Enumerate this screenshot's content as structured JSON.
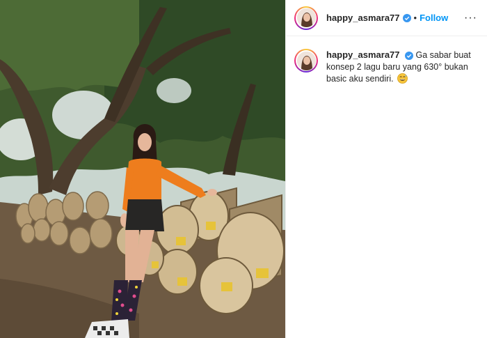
{
  "post": {
    "image_alt": "Woman in orange top sitting on stacked logs under trees"
  },
  "header": {
    "username": "happy_asmara77",
    "separator": "•",
    "follow_label": "Follow",
    "more_label": "···"
  },
  "caption": {
    "username": "happy_asmara77",
    "text": "Ga sabar buat konsep 2 lagu baru yang 630° bukan basic aku sendiri."
  },
  "icons": {
    "verified": "verified-badge-icon",
    "emoji": "grinning-sweat-emoji-icon",
    "more": "more-options-icon"
  },
  "colors": {
    "follow": "#0095f6",
    "verified": "#3897f0",
    "text": "#262626",
    "border": "#efefef"
  }
}
